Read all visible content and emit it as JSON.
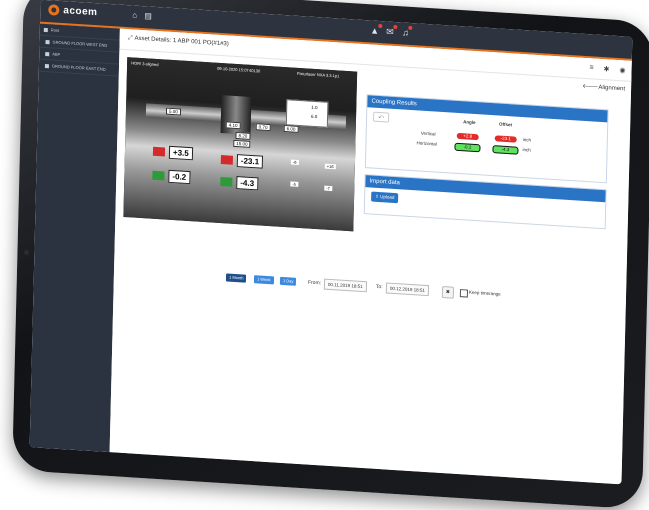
{
  "app": {
    "logo_text": "acoem"
  },
  "topbar": {
    "icons": [
      "home-icon",
      "document-icon"
    ],
    "alert_icons": [
      "alarm-icon",
      "message-icon",
      "bell-icon"
    ]
  },
  "sidebar": {
    "items": [
      {
        "label": "Root"
      },
      {
        "label": "GROUND FLOOR WEST END"
      },
      {
        "label": "ABP"
      },
      {
        "label": "GROUND FLOOR EAST END"
      }
    ]
  },
  "main": {
    "title": "Asset Details: 1 ABP 001 PO(#1#3)",
    "right_icons": [
      "menu-icon",
      "settings-icon",
      "user-icon"
    ],
    "alignment_link": "Alignment"
  },
  "image": {
    "status": "HOR! 3 aligned",
    "timestamp": "09-10-2020 15:07",
    "counter": "40130",
    "device": "Fixturlaser NXA 3.3.1p1",
    "legend_a": "1.0",
    "legend_b": "6.0",
    "dims": [
      "5.00",
      "4.10",
      "0.70",
      "6.00",
      "8.20",
      "15.00"
    ],
    "vert_angle": "+3.5",
    "vert_offset": "-23.1",
    "horiz_angle": "-0.2",
    "horiz_offset": "-4.3",
    "small_vals": [
      "-6",
      "+16",
      "-5",
      "-7"
    ],
    "unit": "/1\""
  },
  "coupling": {
    "heading": "Coupling Results",
    "col_angle": "Angle",
    "col_offset": "Offset",
    "rows": [
      {
        "label": "Vertical",
        "angle": "+2.8",
        "offset": "-23.1",
        "unit": "inch"
      },
      {
        "label": "Horizontal",
        "angle": "-0.2",
        "offset": "-4.3",
        "unit": "inch"
      }
    ]
  },
  "import": {
    "heading": "Import data",
    "upload_label": "Upload"
  },
  "range": {
    "buttons": [
      "1 Month",
      "1 Week",
      "1 Day"
    ],
    "from_label": "From:",
    "from_value": "00.11.2019 18:51",
    "to_label": "To:",
    "to_value": "00.12.2019 18:51",
    "keep_label": "Keep timerange"
  },
  "colors": {
    "accent": "#e8731c",
    "topbar": "#2d3440",
    "primary": "#2a74c6"
  }
}
